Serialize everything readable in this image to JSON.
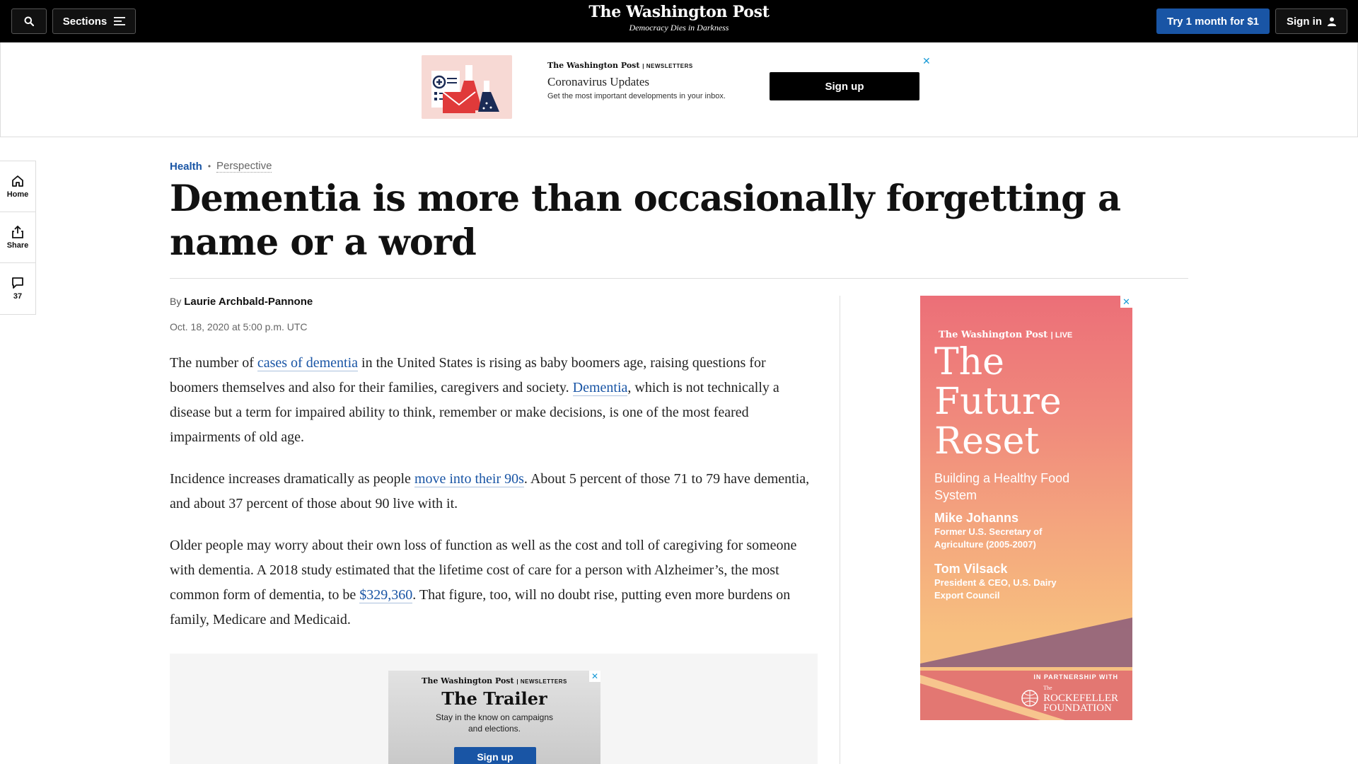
{
  "topbar": {
    "search_icon": "search-icon",
    "sections_label": "Sections",
    "logo": "The Washington Post",
    "tagline": "Democracy Dies in Darkness",
    "try_label": "Try 1 month for $1",
    "signin_label": "Sign in"
  },
  "top_ad": {
    "brand": "The Washington Post",
    "brand_section": "NEWSLETTERS",
    "title": "Coronavirus Updates",
    "description": "Get the most important developments in your inbox.",
    "signup_label": "Sign up",
    "close": "✕"
  },
  "rail": {
    "home": "Home",
    "share": "Share",
    "comments": "37"
  },
  "article": {
    "section": "Health",
    "label": "Perspective",
    "headline": "Dementia is more than occasionally forgetting a name or a word",
    "by": "By",
    "author": "Laurie Archbald-Pannone",
    "date": "Oct. 18, 2020 at 5:00 p.m. UTC",
    "p1": {
      "a": "The number of ",
      "link1": "cases of dementia",
      "b": " in the United States is rising as baby boomers age, raising questions for boomers themselves and also for their families, caregivers and society. ",
      "link2": "Dementia",
      "c": ", which is not technically a disease but a term for impaired ability to think, remember or make decisions, is one of the most feared impairments of old age."
    },
    "p2": {
      "a": "Incidence increases dramatically as people ",
      "link1": "move into their 90s",
      "b": ". About 5 percent of those 71 to 79 have dementia, and about 37 percent of those about 90 live with it."
    },
    "p3": {
      "a": "Older people may worry about their own loss of function as well as the cost and toll of caregiving for someone with dementia. A 2018 study estimated that the lifetime cost of care for a person with Alzheimer’s, the most common form of dementia, to be ",
      "link1": "$329,360",
      "b": ". That figure, too, will no doubt rise, putting even more burdens on family, Medicare and Medicaid."
    }
  },
  "inline_ad": {
    "brand": "The Washington Post",
    "brand_section": "NEWSLETTERS",
    "title": "The Trailer",
    "description": "Stay in the know on campaigns and elections.",
    "signup_label": "Sign up",
    "close": "✕"
  },
  "live_ad": {
    "brand": "The Washington Post",
    "brand_section": "LIVE",
    "title": "The Future Reset",
    "subtitle": "Building a Healthy Food System",
    "speaker1_name": "Mike Johanns",
    "speaker1_role": "Former U.S. Secretary of Agriculture (2005-2007)",
    "speaker2_name": "Tom Vilsack",
    "speaker2_role": "President & CEO, U.S. Dairy Export Council",
    "partner_label": "IN PARTNERSHIP WITH",
    "partner_the": "The",
    "partner_name1": "ROCKEFELLER",
    "partner_name2": "FOUNDATION",
    "close": "✕"
  },
  "colors": {
    "accent_blue": "#1955a5",
    "nav_bg": "#000000",
    "ad_close": "#1a9bd7"
  }
}
